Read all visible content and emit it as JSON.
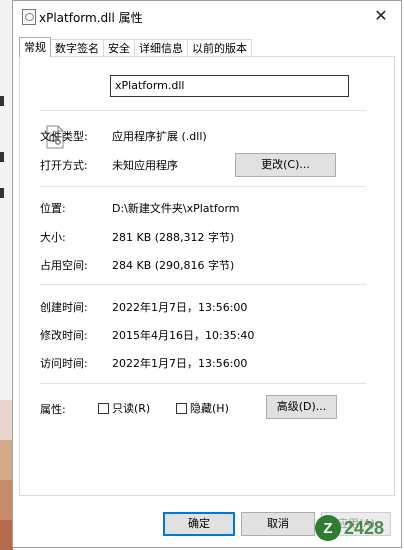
{
  "window": {
    "title": "xPlatform.dll 属性"
  },
  "tabs": [
    {
      "label": "常规"
    },
    {
      "label": "数字签名"
    },
    {
      "label": "安全"
    },
    {
      "label": "详细信息"
    },
    {
      "label": "以前的版本"
    }
  ],
  "general": {
    "file_name": "xPlatform.dll",
    "type_label": "文件类型:",
    "type_value": "应用程序扩展 (.dll)",
    "open_with_label": "打开方式:",
    "open_with_value": "未知应用程序",
    "change_button": "更改(C)...",
    "location_label": "位置:",
    "location_value": "D:\\新建文件夹\\xPlatform",
    "size_label": "大小:",
    "size_value": "281 KB (288,312 字节)",
    "size_on_disk_label": "占用空间:",
    "size_on_disk_value": "284 KB (290,816 字节)",
    "created_label": "创建时间:",
    "created_value": "2022年1月7日，13:56:00",
    "modified_label": "修改时间:",
    "modified_value": "2015年4月16日，10:35:40",
    "accessed_label": "访问时间:",
    "accessed_value": "2022年1月7日，13:56:00",
    "attributes_label": "属性:",
    "readonly_label": "只读(R)",
    "hidden_label": "隐藏(H)",
    "advanced_button": "高级(D)..."
  },
  "footer": {
    "ok_button": "确定",
    "cancel_button": "取消",
    "apply_button": "应用(A)"
  },
  "watermark": {
    "text": "Z 2428"
  },
  "colors": {
    "accent": "#0078d7",
    "button_bg": "#e1e1e1"
  }
}
